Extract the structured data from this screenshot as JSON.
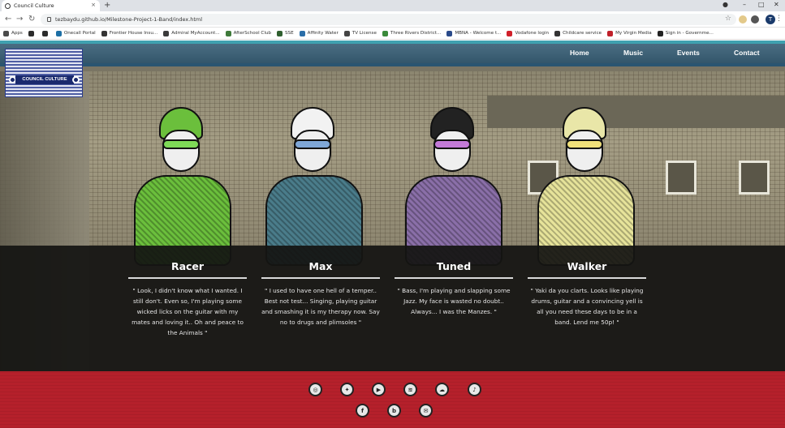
{
  "browser": {
    "tab_title": "Council Culture",
    "tab_close": "×",
    "new_tab": "+",
    "url": "tezbaydu.github.io/Milestone-Project-1-Band/index.html",
    "profile_initial": "T",
    "bookmarks": [
      {
        "label": "Apps",
        "color": "#4a4a4a"
      },
      {
        "label": "",
        "color": "#2b2b2b"
      },
      {
        "label": "",
        "color": "#2b2b2b"
      },
      {
        "label": "Onecall Portal",
        "color": "#1d6fa5"
      },
      {
        "label": "Frontier House Insu...",
        "color": "#333333"
      },
      {
        "label": "Admiral MyAccount...",
        "color": "#3a3a3a"
      },
      {
        "label": "AfterSchool Club",
        "color": "#3f7a3a"
      },
      {
        "label": "SSE",
        "color": "#2f5f2f"
      },
      {
        "label": "Affinity Water",
        "color": "#2b6ea8"
      },
      {
        "label": "TV License",
        "color": "#444444"
      },
      {
        "label": "Three Rivers District...",
        "color": "#3a8a3a"
      },
      {
        "label": "MBNA - Welcome t...",
        "color": "#2a4a8a"
      },
      {
        "label": "Vodafone login",
        "color": "#d0202a"
      },
      {
        "label": "Childcare service",
        "color": "#333333"
      },
      {
        "label": "My Virgin Media",
        "color": "#c0202a"
      },
      {
        "label": "Sign in - Governme...",
        "color": "#222222"
      }
    ]
  },
  "site": {
    "logo_text": "COUNCIL CULTURE",
    "nav": [
      "Home",
      "Music",
      "Events",
      "Contact"
    ]
  },
  "members": [
    {
      "name": "Racer",
      "hat_color": "#6bbf3c",
      "body_color": "#6bbf3c",
      "shades_color": "#7ed957",
      "quote": "\" Look, I didn't know what I wanted. I still don't. Even so, I'm playing some wicked licks on the guitar with my mates and loving it.. Oh and peace to the Animals \""
    },
    {
      "name": "Max",
      "hat_color": "#f2f2f2",
      "body_color": "#4a7c8a",
      "shades_color": "#7fa7d8",
      "quote": "\" I used to have one hell of a temper.. Best not test... Singing, playing guitar and smashing it is my therapy now. Say no to drugs and plimsoles \""
    },
    {
      "name": "Tuned",
      "hat_color": "#222222",
      "body_color": "#8a6fa8",
      "shades_color": "#c37ad8",
      "quote": "\" Bass, I'm playing and slapping some Jazz. My face is wasted no doubt.. Always... I was the Manzes. \""
    },
    {
      "name": "Walker",
      "hat_color": "#e9e6a8",
      "body_color": "#e6e39a",
      "shades_color": "#f0e07a",
      "quote": "\" Yaki da you clarts. Looks like playing drums, guitar and a convincing yell is all you need these days to be in a band. Lend me 50p! \""
    }
  ],
  "social_icons": [
    "instagram-icon",
    "twitter-icon",
    "youtube-icon",
    "spotify-icon",
    "soundcloud-icon",
    "apple-music-icon",
    "facebook-icon",
    "bandcamp-icon",
    "email-icon"
  ],
  "colors": {
    "nav_bar": "#3f6379",
    "accent_stripe": "#3fa1b0",
    "members_band": "#151512",
    "footer": "#b5202b"
  }
}
